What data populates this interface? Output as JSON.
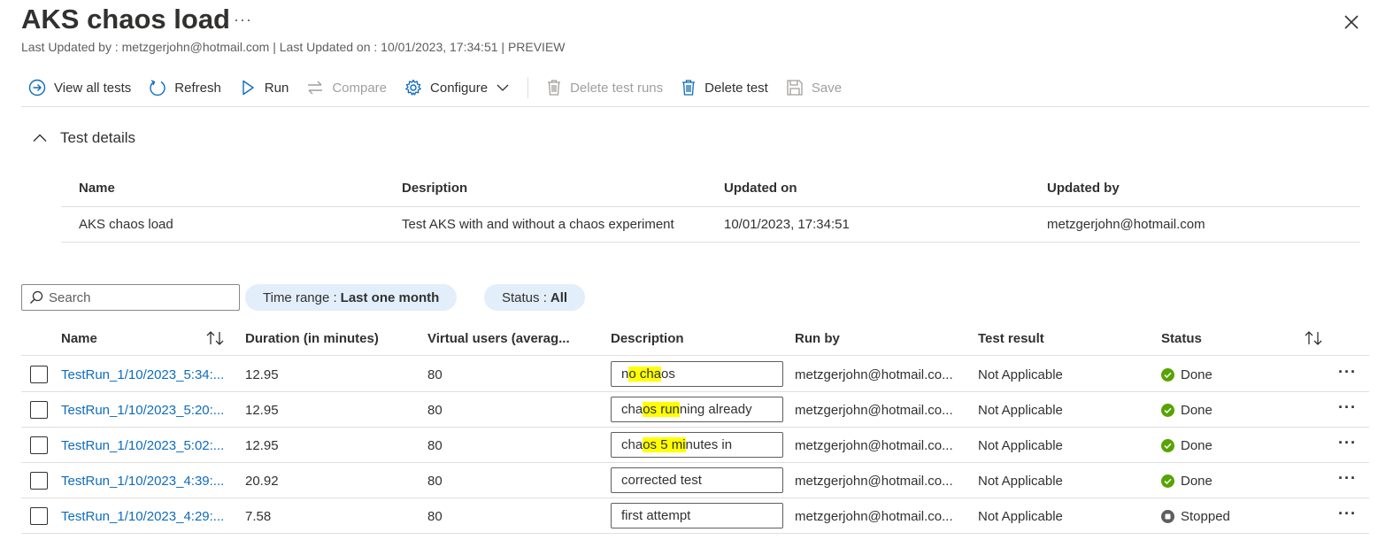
{
  "header": {
    "title": "AKS chaos load",
    "more": "···",
    "subtitle": "Last Updated by : metzgerjohn@hotmail.com | Last Updated on : 10/01/2023, 17:34:51 | PREVIEW"
  },
  "toolbar": {
    "view_all": "View all tests",
    "refresh": "Refresh",
    "run": "Run",
    "compare": "Compare",
    "configure": "Configure",
    "delete_runs": "Delete test runs",
    "delete_test": "Delete test",
    "save": "Save"
  },
  "details": {
    "section_label": "Test details",
    "headers": [
      "Name",
      "Desription",
      "Updated on",
      "Updated by"
    ],
    "row": [
      "AKS chaos load",
      "Test AKS with and without a chaos experiment",
      "10/01/2023, 17:34:51",
      "metzgerjohn@hotmail.com"
    ]
  },
  "filters": {
    "search_placeholder": "Search",
    "time_range_label": "Time range :",
    "time_range_value": "Last one month",
    "status_label": "Status :",
    "status_value": "All"
  },
  "grid": {
    "headers": [
      "Name",
      "Duration (in minutes)",
      "Virtual users (averag...",
      "Description",
      "Run by",
      "Test result",
      "Status"
    ],
    "rows": [
      {
        "name": "TestRun_1/10/2023_5:34:...",
        "duration": "12.95",
        "vusers": "80",
        "desc_a": "n",
        "desc_hl": "o cha",
        "desc_b": "os",
        "run_by": "metzgerjohn@hotmail.co...",
        "result": "Not Applicable",
        "status": "Done"
      },
      {
        "name": "TestRun_1/10/2023_5:20:...",
        "duration": "12.95",
        "vusers": "80",
        "desc_a": "cha",
        "desc_hl": "os run",
        "desc_b": "ning already",
        "run_by": "metzgerjohn@hotmail.co...",
        "result": "Not Applicable",
        "status": "Done"
      },
      {
        "name": "TestRun_1/10/2023_5:02:...",
        "duration": "12.95",
        "vusers": "80",
        "desc_a": "cha",
        "desc_hl": "os 5 mi",
        "desc_b": "nutes in",
        "run_by": "metzgerjohn@hotmail.co...",
        "result": "Not Applicable",
        "status": "Done"
      },
      {
        "name": "TestRun_1/10/2023_4:39:...",
        "duration": "20.92",
        "vusers": "80",
        "desc_a": "corrected test",
        "desc_hl": "",
        "desc_b": "",
        "run_by": "metzgerjohn@hotmail.co...",
        "result": "Not Applicable",
        "status": "Done"
      },
      {
        "name": "TestRun_1/10/2023_4:29:...",
        "duration": "7.58",
        "vusers": "80",
        "desc_a": "first attempt",
        "desc_hl": "",
        "desc_b": "",
        "run_by": "metzgerjohn@hotmail.co...",
        "result": "Not Applicable",
        "status": "Stopped"
      }
    ],
    "row_more": "···"
  },
  "colors": {
    "accent": "#0f6cbd",
    "done_green": "#57a300",
    "stopped_gray": "#605e5c",
    "highlight": "#ffff00",
    "pill_bg": "#e2eefa"
  }
}
